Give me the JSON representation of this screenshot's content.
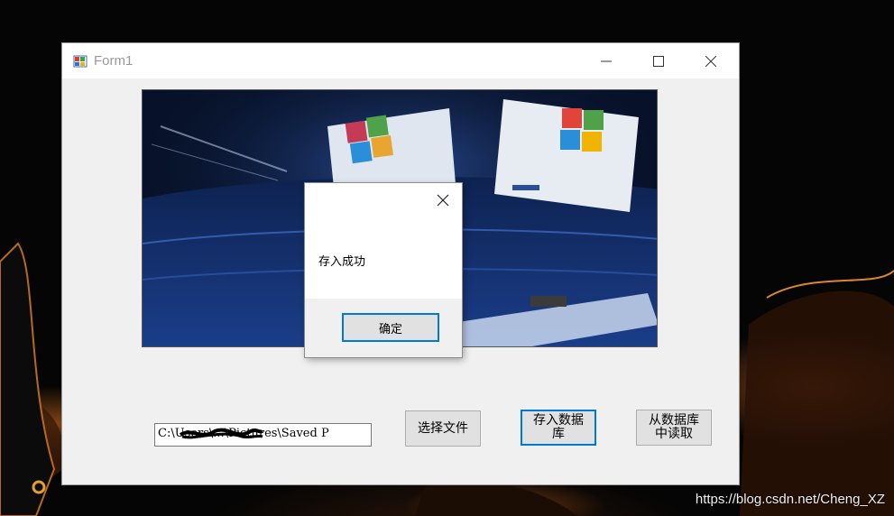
{
  "window": {
    "title": "Form1",
    "minimize_icon": "minimize-icon",
    "maximize_icon": "maximize-icon",
    "close_icon": "close-icon"
  },
  "form": {
    "file_path_value": "C:\\Users\\...\\Pictures\\Saved P",
    "select_file_label": "选择文件",
    "save_to_db_label_line1": "存入数据",
    "save_to_db_label_line2": "库",
    "read_from_db_label_line1": "从数据库",
    "read_from_db_label_line2": "中读取"
  },
  "dialog": {
    "message": "存入成功",
    "ok_label": "确定"
  },
  "watermark": "https://blog.csdn.net/Cheng_XZ",
  "colors": {
    "accent": "#0078d7",
    "button_face": "#e1e1e1",
    "window_bg": "#f0f0f0"
  }
}
